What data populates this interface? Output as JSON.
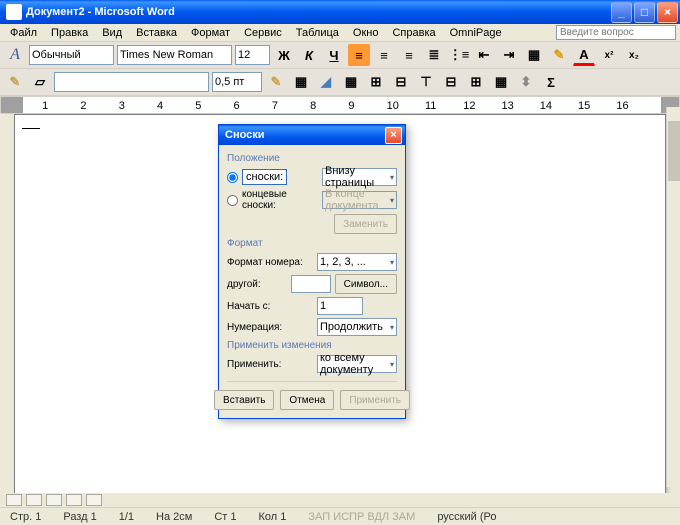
{
  "title": "Документ2 - Microsoft Word",
  "menu": [
    "Файл",
    "Правка",
    "Вид",
    "Вставка",
    "Формат",
    "Сервис",
    "Таблица",
    "Окно",
    "Справка",
    "OmniPage"
  ],
  "askplaceholder": "Введите вопрос",
  "fmt": {
    "style": "Обычный",
    "font": "Times New Roman",
    "size": "12"
  },
  "tb2": {
    "weight": "0,5 пт"
  },
  "ruler_ticks": [
    "1",
    "2",
    "3",
    "4",
    "5",
    "6",
    "7",
    "8",
    "9",
    "10",
    "11",
    "12",
    "13",
    "14",
    "15",
    "16"
  ],
  "status": {
    "page": "Стр. 1",
    "sect": "Разд 1",
    "pages": "1/1",
    "pos": "На 2см",
    "line": "Ст 1",
    "col": "Кол 1",
    "flags": "ЗАП ИСПР ВДЛ ЗАМ",
    "lang": "русский (Ро"
  },
  "dlg": {
    "title": "Сноски",
    "grp_pos": "Положение",
    "radio_footnote": "сноски:",
    "radio_endnote": "концевые сноски:",
    "pos_footnote": "Внизу страницы",
    "pos_endnote": "В конце документа",
    "btn_convert": "Заменить",
    "grp_fmt": "Формат",
    "lbl_numfmt": "Формат номера:",
    "val_numfmt": "1, 2, 3, ...",
    "lbl_custom": "другой:",
    "btn_symbol": "Символ...",
    "lbl_start": "Начать с:",
    "val_start": "1",
    "lbl_numbering": "Нумерация:",
    "val_numbering": "Продолжить",
    "grp_apply": "Применить изменения",
    "lbl_applyto": "Применить:",
    "val_applyto": "ко всему документу",
    "btn_insert": "Вставить",
    "btn_cancel": "Отмена",
    "btn_apply": "Применить"
  }
}
